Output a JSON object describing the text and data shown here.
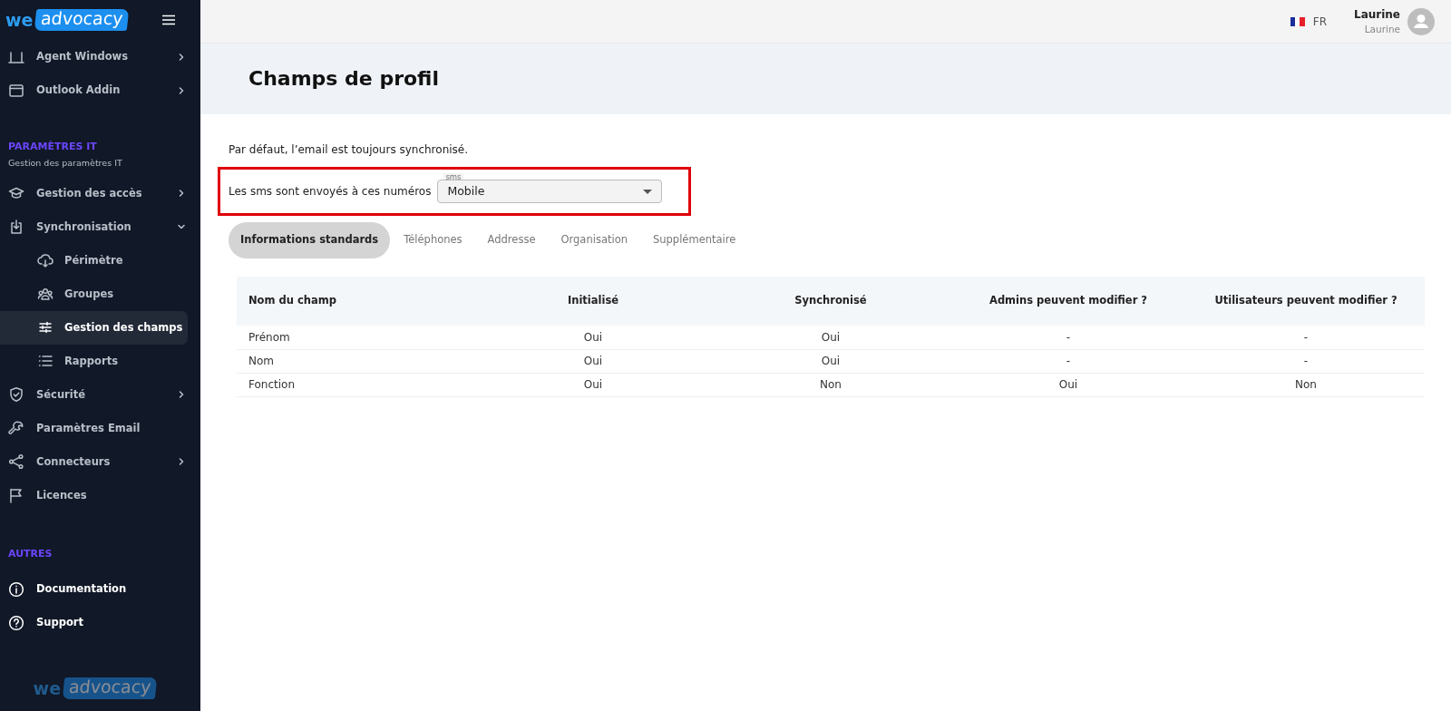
{
  "sidebar": {
    "logo": {
      "left": "we",
      "right": "advocacy"
    },
    "sections": [
      {
        "items": [
          {
            "label": "Agent Windows",
            "kind": "group",
            "expanded": false,
            "selected": false
          },
          {
            "label": "Outlook Addin",
            "kind": "group",
            "expanded": false,
            "selected": false
          }
        ]
      },
      {
        "title": "PARAMÈTRES IT",
        "subtitle": "Gestion des paramètres IT",
        "items": [
          {
            "label": "Gestion des accès",
            "kind": "group",
            "expanded": false,
            "selected": false
          },
          {
            "label": "Synchronisation",
            "kind": "group",
            "expanded": true,
            "selected": false,
            "children": [
              {
                "label": "Périmètre",
                "selected": false
              },
              {
                "label": "Groupes",
                "selected": false
              },
              {
                "label": "Gestion des champs",
                "selected": true
              },
              {
                "label": "Rapports",
                "selected": false
              }
            ]
          },
          {
            "label": "Sécurité",
            "kind": "group",
            "expanded": false,
            "selected": false
          },
          {
            "label": "Paramètres Email",
            "kind": "link",
            "selected": false
          },
          {
            "label": "Connecteurs",
            "kind": "group",
            "expanded": false,
            "selected": false
          },
          {
            "label": "Licences",
            "kind": "link",
            "selected": false
          }
        ]
      },
      {
        "title": "AUTRES",
        "items": [
          {
            "label": "Documentation",
            "kind": "resource",
            "selected": false
          },
          {
            "label": "Support",
            "kind": "resource",
            "selected": false
          }
        ]
      }
    ],
    "footer_logo": {
      "left": "we",
      "right": "advocacy"
    }
  },
  "header": {
    "language": "FR",
    "user": {
      "name": "Laurine",
      "subtitle": "Laurine"
    }
  },
  "page": {
    "title": "Champs de profil",
    "note": "Par défaut, l’email est toujours synchronisé.",
    "sms_setting": {
      "label": "Les sms sont envoyés à ces numéros",
      "field_label": "sms",
      "value": "Mobile",
      "highlighted": true
    },
    "tabs": [
      {
        "label": "Informations standards",
        "selected": true
      },
      {
        "label": "Téléphones",
        "selected": false
      },
      {
        "label": "Addresse",
        "selected": false
      },
      {
        "label": "Organisation",
        "selected": false
      },
      {
        "label": "Supplémentaire",
        "selected": false
      }
    ],
    "table": {
      "columns": [
        "Nom du champ",
        "Initialisé",
        "Synchronisé",
        "Admins peuvent modifier ?",
        "Utilisateurs peuvent modifier ?"
      ],
      "rows": [
        [
          "Prénom",
          "Oui",
          "Oui",
          "-",
          "-"
        ],
        [
          "Nom",
          "Oui",
          "Oui",
          "-",
          "-"
        ],
        [
          "Fonction",
          "Oui",
          "Non",
          "Oui",
          "Non"
        ]
      ]
    }
  }
}
